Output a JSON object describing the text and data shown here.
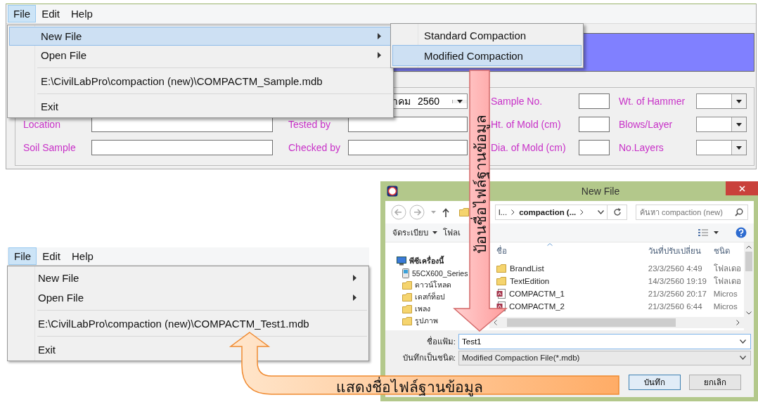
{
  "top_window": {
    "menu_bar": [
      {
        "label": "File",
        "selected": true
      },
      {
        "label": "Edit",
        "selected": false
      },
      {
        "label": "Help",
        "selected": false
      }
    ],
    "date_combo": {
      "month": "าคม",
      "year": "2560"
    },
    "general_fields": [
      {
        "label": "Location"
      },
      {
        "label": "Soil Sample"
      }
    ],
    "person_fields": [
      {
        "label": "Tested by"
      },
      {
        "label": "Checked by"
      }
    ],
    "mold_fields": [
      {
        "label": "Sample No."
      },
      {
        "label": "Ht. of Mold (cm)"
      },
      {
        "label": "Dia. of Mold (cm)"
      }
    ],
    "setting_fields": [
      {
        "label": "Wt. of Hammer"
      },
      {
        "label": "Blows/Layer"
      },
      {
        "label": "No.Layers"
      }
    ],
    "file_menu": [
      {
        "kind": "submenu",
        "label": "New File",
        "selected": true
      },
      {
        "kind": "submenu",
        "label": "Open File",
        "selected": false
      },
      {
        "kind": "separator"
      },
      {
        "kind": "item",
        "label": "E:\\CivilLabPro\\compaction (new)\\COMPACTM_Sample.mdb",
        "selected": false
      },
      {
        "kind": "separator"
      },
      {
        "kind": "item",
        "label": "Exit",
        "selected": false
      }
    ],
    "new_file_submenu": [
      {
        "label": "Standard Compaction",
        "selected": false
      },
      {
        "label": "Modified Compaction",
        "selected": true
      }
    ]
  },
  "dialog": {
    "title": "New File",
    "address": [
      "l...",
      "compaction (..."
    ],
    "search_placeholder": "ค้นหา compaction (new)",
    "toolbar": [
      {
        "kind": "dropdown",
        "label": "จัดระเบียบ"
      },
      {
        "kind": "button",
        "label": "โฟลเ"
      }
    ],
    "nav_pane": [
      {
        "kind": "computer",
        "label": "พีซีเครื่องนี้",
        "children": [
          {
            "kind": "device",
            "label": "55CX600_Series"
          },
          {
            "kind": "folder",
            "label": "ดาวน์โหลด"
          },
          {
            "kind": "folder",
            "label": "เดสก์ท็อป"
          },
          {
            "kind": "folder",
            "label": "เพลง"
          },
          {
            "kind": "folder",
            "label": "รูปภาพ"
          }
        ]
      }
    ],
    "columns": [
      "ชื่อ",
      "วันที่ปรับเปลี่ยน",
      "ชนิด"
    ],
    "files": [
      {
        "kind": "folder",
        "name": "BrandList",
        "modified": "23/3/2560 4:49",
        "type": "โฟลเดอ"
      },
      {
        "kind": "folder",
        "name": "TextEdition",
        "modified": "14/3/2560 19:19",
        "type": "โฟลเดอ"
      },
      {
        "kind": "database",
        "name": "COMPACTM_1",
        "modified": "21/3/2560 20:17",
        "type": "Micros"
      },
      {
        "kind": "database",
        "name": "COMPACTM_2",
        "modified": "21/3/2560 6:44",
        "type": "Micros"
      }
    ],
    "file_name": {
      "label": "ชื่อแฟ้ม:",
      "value": "Test1"
    },
    "save_type": {
      "label": "บันทึกเป็นชนิด:",
      "value": "Modified Compaction File(*.mdb)"
    },
    "buttons": [
      {
        "kind": "default",
        "label": "บันทึก"
      },
      {
        "kind": "normal",
        "label": "ยกเลิก"
      }
    ]
  },
  "bottom_window": {
    "menu_bar": [
      {
        "label": "File",
        "selected": true
      },
      {
        "label": "Edit",
        "selected": false
      },
      {
        "label": "Help",
        "selected": false
      }
    ],
    "file_menu": [
      {
        "kind": "submenu",
        "label": "New File",
        "selected": false
      },
      {
        "kind": "submenu",
        "label": "Open File",
        "selected": false
      },
      {
        "kind": "separator"
      },
      {
        "kind": "item",
        "label": "E:\\CivilLabPro\\compaction (new)\\COMPACTM_Test1.mdb",
        "selected": false
      },
      {
        "kind": "separator"
      },
      {
        "kind": "item",
        "label": "Exit",
        "selected": false
      }
    ]
  },
  "callouts": [
    {
      "kind": "down",
      "text": "ป้อนชื่อไฟล์ฐานข้อมูล"
    },
    {
      "kind": "curved",
      "text": "แสดงชื่อไฟล์ฐานข้อมูล"
    }
  ]
}
